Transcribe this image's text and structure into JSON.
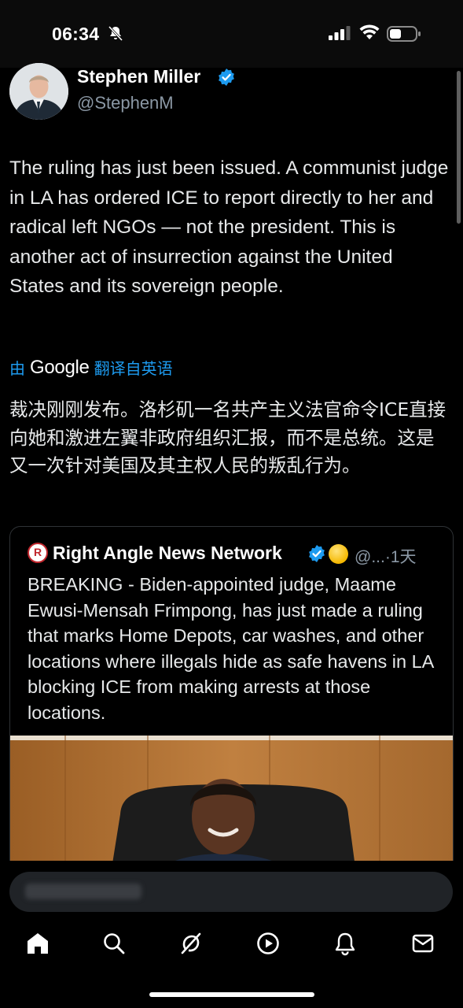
{
  "status_bar": {
    "time": "06:34",
    "icons": [
      "bell-slash-icon",
      "signal-icon",
      "wifi-icon",
      "battery-icon"
    ]
  },
  "author": {
    "name": "Stephen Miller",
    "handle": "@StephenM",
    "verified": true
  },
  "tweet": {
    "text": "The ruling has just been issued. A communist judge in LA has ordered ICE to report directly to her and radical left NGOs — not the president. This is another act of insurrection against the United States and its sovereign people."
  },
  "translation": {
    "prefix": "由",
    "provider": "Google",
    "suffix": "翻译自英语",
    "text": "裁决刚刚发布。洛杉矶一名共产主义法官命令ICE直接向她和激进左翼非政府组织汇报，而不是总统。这是又一次针对美国及其主权人民的叛乱行为。"
  },
  "quoted_tweet": {
    "logo_letter": "R",
    "name": "Right Angle News Network",
    "handle": "@...",
    "time": "·1天",
    "text": "BREAKING - Biden-appointed judge, Maame Ewusi-Mensah Frimpong, has just made a ruling that marks Home Depots, car washes, and other locations where illegals hide as safe havens in LA blocking ICE from making arrests at those locations."
  },
  "tab_bar": {
    "items": [
      "home-icon",
      "search-icon",
      "grok-icon",
      "play-icon",
      "notifications-icon",
      "messages-icon"
    ]
  },
  "colors": {
    "background": "#000000",
    "text": "#e7e9ea",
    "secondary": "#8b98a5",
    "accent": "#1d9bf0"
  }
}
